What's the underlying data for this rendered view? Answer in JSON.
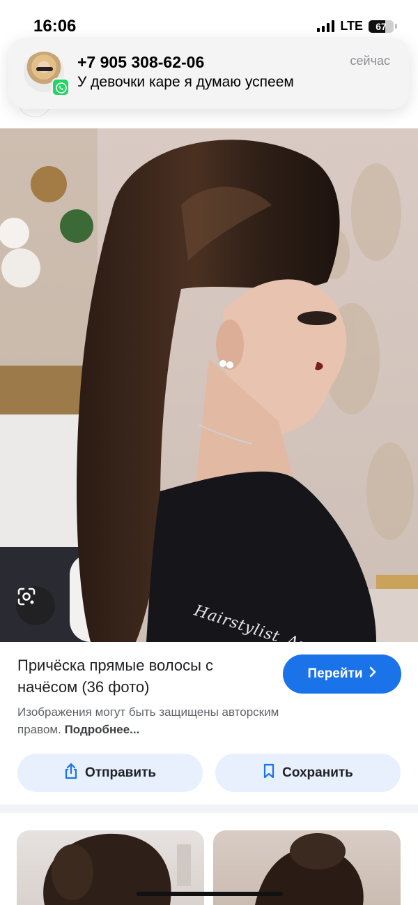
{
  "status_bar": {
    "time": "16:06",
    "network": "LTE",
    "battery": "67",
    "battery_fraction": 0.67
  },
  "notification": {
    "title": "+7 905 308-62-06",
    "message": "У девочки каре я думаю успеем",
    "time": "сейчас",
    "app_icon": "whatsapp-icon"
  },
  "image": {
    "watermark": "Hairstylist_Ani",
    "lens_icon": "lens-icon"
  },
  "result": {
    "title": "Причёска прямые волосы с начёсом (36 фото)",
    "go_label": "Перейти",
    "copyright_text": "Изображения могут быть защищены авторским правом.",
    "more_label": "Подробнее..."
  },
  "actions": {
    "share_label": "Отправить",
    "save_label": "Сохранить"
  },
  "colors": {
    "accent": "#1a73e8",
    "action_bg": "#e8f0fe",
    "whatsapp": "#25d366"
  }
}
